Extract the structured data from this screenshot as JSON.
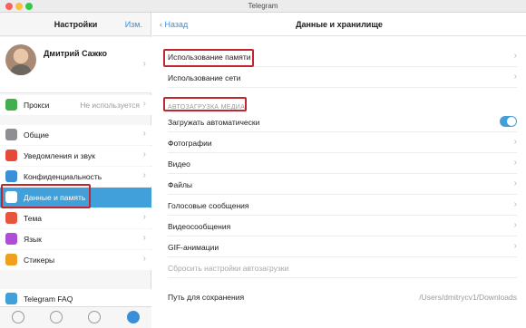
{
  "window": {
    "title": "Telegram"
  },
  "sidebar": {
    "title": "Настройки",
    "edit_label": "Изм.",
    "profile": {
      "name": "Дмитрий Сажко"
    },
    "proxy": {
      "label": "Прокси",
      "value": "Не используется"
    },
    "items": [
      {
        "label": "Общие",
        "icon": "gear-icon",
        "color": "#8e8e93"
      },
      {
        "label": "Уведомления и звук",
        "icon": "bell-icon",
        "color": "#e5493a"
      },
      {
        "label": "Конфиденциальность",
        "icon": "lock-icon",
        "color": "#3a8fd6"
      },
      {
        "label": "Данные и память",
        "icon": "database-icon",
        "color": "#419fd9",
        "active": true
      },
      {
        "label": "Тема",
        "icon": "palette-icon",
        "color": "#e8553d"
      },
      {
        "label": "Язык",
        "icon": "globe-icon",
        "color": "#b04dd6"
      },
      {
        "label": "Стикеры",
        "icon": "sticker-icon",
        "color": "#f0a020"
      }
    ],
    "faq": {
      "label": "Telegram FAQ",
      "icon": "faq-icon",
      "color": "#419fd9"
    },
    "proxy_icon_color": "#3fb04c",
    "bottom_nav": [
      "contacts-icon",
      "calls-icon",
      "chats-icon",
      "settings-icon"
    ]
  },
  "main": {
    "back_label": "Назад",
    "title": "Данные и хранилище",
    "storage_usage": "Использование памяти",
    "network_usage": "Использование сети",
    "autodownload_section": "АВТОЗАГРУЗКА МЕДИА",
    "auto_download": "Загружать автоматически",
    "auto_download_on": true,
    "media_types": [
      "Фотографии",
      "Видео",
      "Файлы",
      "Голосовые сообщения",
      "Видеосообщения",
      "GIF-анимации"
    ],
    "reset_label": "Сбросить настройки автозагрузки",
    "save_path_label": "Путь для сохранения",
    "save_path_value": "/Users/dmitrycv1/Downloads"
  },
  "colors": {
    "accent": "#419fd9",
    "highlight_box": "#c0262e"
  }
}
